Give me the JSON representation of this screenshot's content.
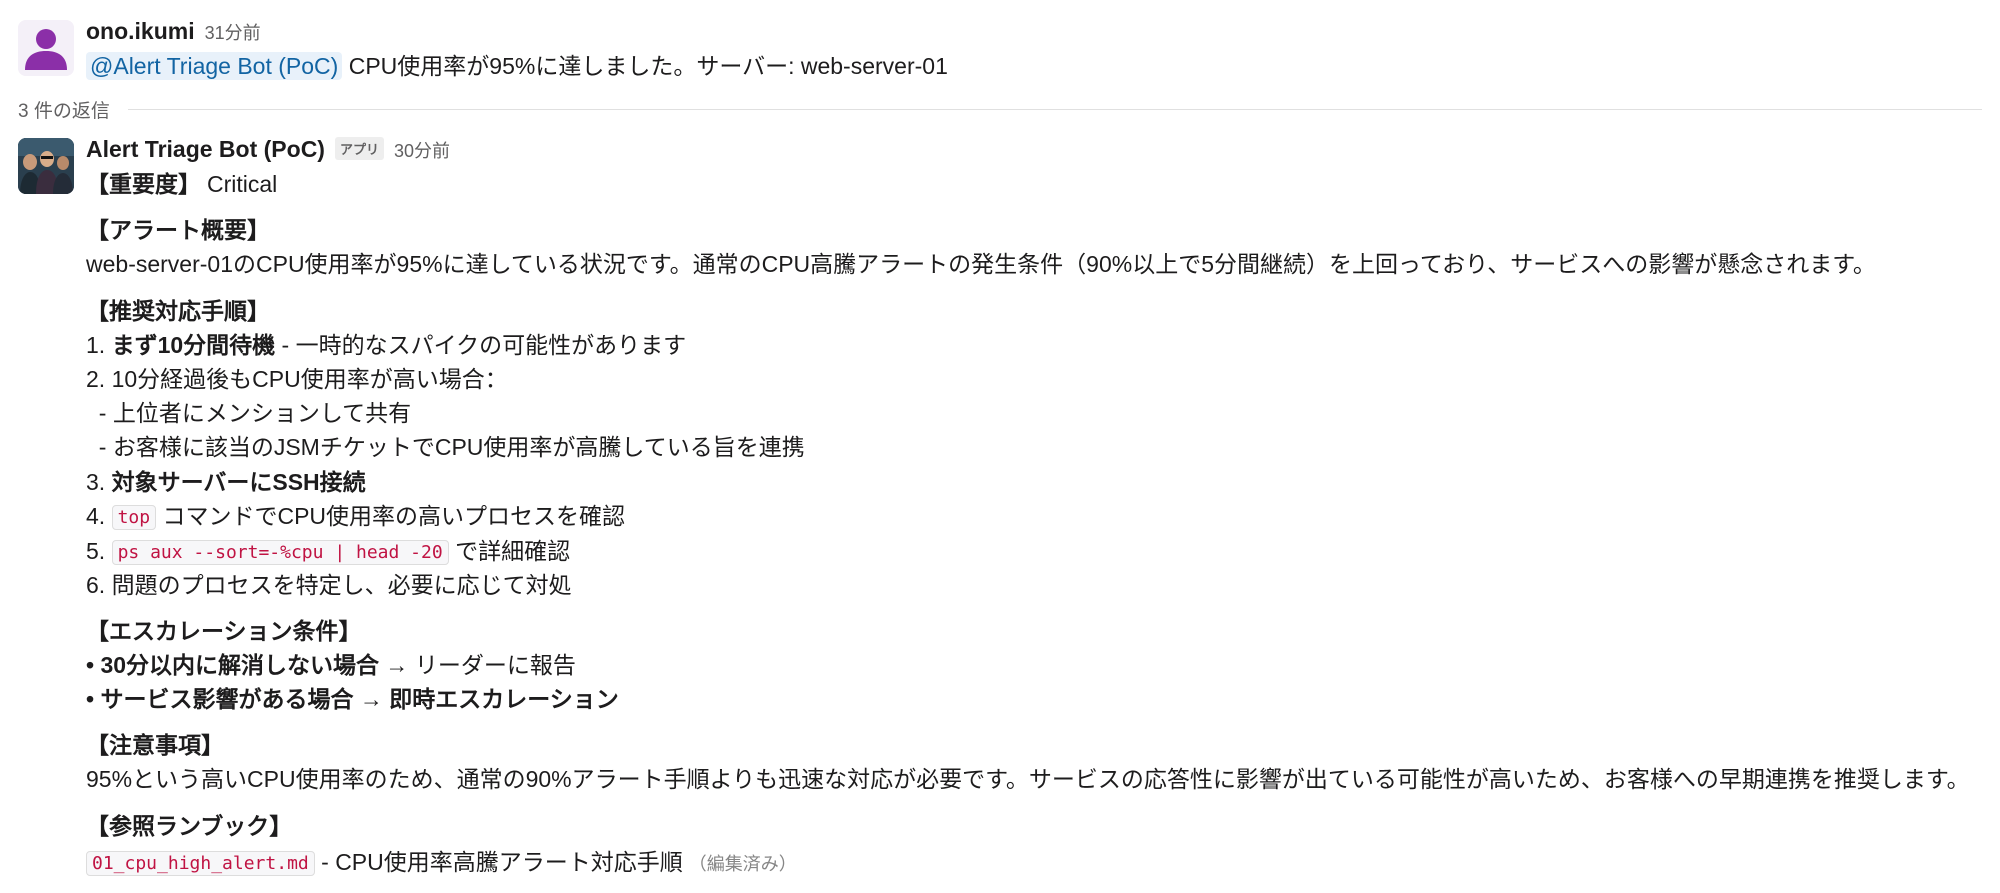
{
  "thread": {
    "root": {
      "author": "ono.ikumi",
      "time": "31分前",
      "mention": "@Alert Triage Bot (PoC)",
      "text": " CPU使用率が95%に達しました。サーバー: web-server-01"
    },
    "reply_count": "3 件の返信",
    "reply": {
      "author": "Alert Triage Bot (PoC)",
      "app_badge": "アプリ",
      "time": "30分前",
      "severity_label": "【重要度】",
      "severity_value": "Critical",
      "overview_heading": "【アラート概要】",
      "overview_text": "web-server-01のCPU使用率が95%に達している状況です。通常のCPU高騰アラートの発生条件（90%以上で5分間継続）を上回っており、サービスへの影響が懸念されます。",
      "steps_heading": "【推奨対応手順】",
      "step1_num": "1. ",
      "step1_bold": "まず10分間待機",
      "step1_rest": " - 一時的なスパイクの可能性があります",
      "step2": "2. 10分経過後もCPU使用率が高い場合：",
      "step2_sub1": "  - 上位者にメンションして共有",
      "step2_sub2": "  - お客様に該当のJSMチケットでCPU使用率が高騰している旨を連携",
      "step3_num": "3. ",
      "step3_bold": "対象サーバーにSSH接続",
      "step4_num": "4. ",
      "step4_code": "top",
      "step4_rest": " コマンドでCPU使用率の高いプロセスを確認",
      "step5_num": "5. ",
      "step5_code": "ps aux --sort=-%cpu | head -20",
      "step5_rest": " で詳細確認",
      "step6": "6. 問題のプロセスを特定し、必要に応じて対処",
      "escalation_heading": "【エスカレーション条件】",
      "esc1_bullet": "• ",
      "esc1_bold": "30分以内に解消しない場合",
      "esc1_rest": " → リーダーに報告",
      "esc2_bullet": "• ",
      "esc2_bold": "サービス影響がある場合",
      "esc2_mid": " → ",
      "esc2_bold2": "即時エスカレーション",
      "notes_heading": "【注意事項】",
      "notes_text": "95%という高いCPU使用率のため、通常の90%アラート手順よりも迅速な対応が必要です。サービスの応答性に影響が出ている可能性が高いため、お客様への早期連携を推奨します。",
      "runbook_heading": "【参照ランブック】",
      "runbook_code": "01_cpu_high_alert.md",
      "runbook_rest": " - CPU使用率高騰アラート対応手順",
      "edited_label": "（編集済み）"
    }
  },
  "colors": {
    "mention": "#1264a3",
    "code": "#c01343",
    "user_avatar": "#8b2fa8"
  },
  "icons": {
    "user_avatar": "user-silhouette",
    "bot_avatar": "bot-photo"
  }
}
